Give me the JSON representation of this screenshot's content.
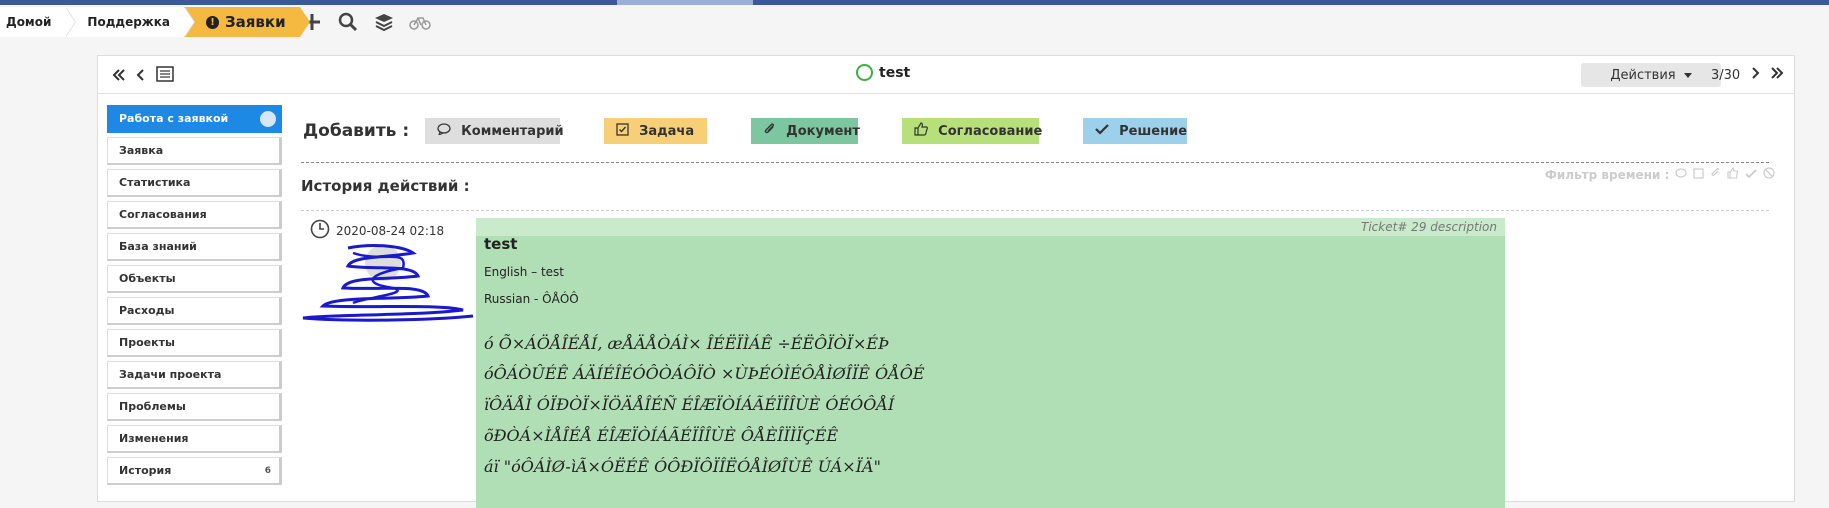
{
  "breadcrumbs": {
    "home": "Домой",
    "support": "Поддержка",
    "tickets": "Заявки"
  },
  "toolbar_icons": [
    "plus-icon",
    "search-icon",
    "layers-icon",
    "bike-icon"
  ],
  "nav": {
    "title": "test",
    "actions_label": "Действия",
    "pager": "3/30"
  },
  "sidebar": {
    "items": [
      {
        "label": "Работа с заявкой",
        "badge": ""
      },
      {
        "label": "Заявка",
        "badge": ""
      },
      {
        "label": "Статистика",
        "badge": ""
      },
      {
        "label": "Согласования",
        "badge": ""
      },
      {
        "label": "База знаний",
        "badge": ""
      },
      {
        "label": "Объекты",
        "badge": ""
      },
      {
        "label": "Расходы",
        "badge": ""
      },
      {
        "label": "Проекты",
        "badge": ""
      },
      {
        "label": "Задачи проекта",
        "badge": ""
      },
      {
        "label": "Проблемы",
        "badge": ""
      },
      {
        "label": "Изменения",
        "badge": ""
      },
      {
        "label": "История",
        "badge": "6"
      }
    ]
  },
  "add": {
    "label": "Добавить :",
    "comment": "Комментарий",
    "task": "Задача",
    "document": "Документ",
    "approval": "Согласование",
    "decision": "Решение"
  },
  "history": {
    "title": "История действий :",
    "filter_label": "Фильтр времени :"
  },
  "entry": {
    "timestamp": "2020-08-24 02:18",
    "header": "Ticket# 29 description",
    "title": "test",
    "line1": "English – test",
    "line2": "Russian - ÔÅÓÔ",
    "mojibake1": "ó Õ×ÁÖÅÎÉÅÍ, æÅÄÅÒÁÌ× ÎÉËÏÌÁÊ ÷ÉËÔÏÒÏ×ÉÞ",
    "mojibake2": "óÔÁÒÛÉÊ ÁÄÍÉÎÉÓÔÒÁÔÏÒ ×ÙÞÉÓÌÉÔÅÌØÎÏÊ ÓÅÔÉ",
    "mojibake3": "ïÔÄÅÌ ÓÏÐÒÏ×ÏÖÄÅÎÉÑ ÉÎÆÏÒÍÁÃÉÏÎÎÙÈ ÓÉÓÔÅÍ",
    "mojibake4": "õÐÒÁ×ÌÅÎÉÅ ÉÎÆÏÒÍÁÃÉÏÎÎÙÈ ÔÅÈÎÏÌÏÇÉÊ",
    "mojibake5": "áï \"óÔÁÌØ-ìÃ×ÓËÉÊ ÓÔÐÏÔÏÎËÓÅÌØÎÙÊ ÚÁ×ÏÄ\""
  }
}
